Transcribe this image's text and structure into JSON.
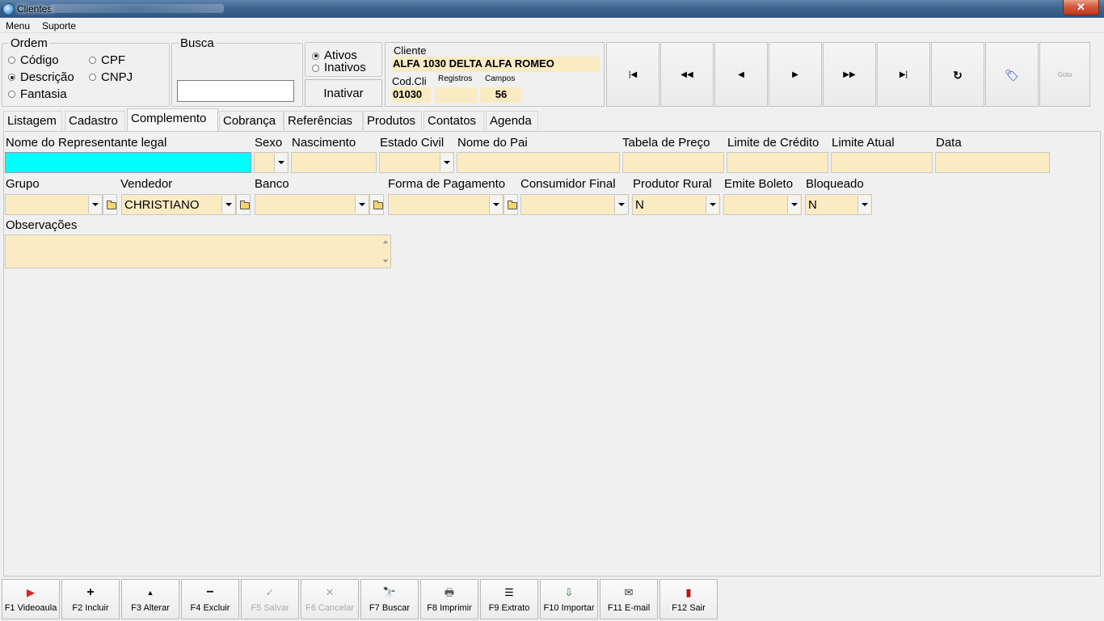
{
  "window": {
    "title": "Clientes",
    "close_label": "✕"
  },
  "menu": {
    "items": [
      "Menu",
      "Suporte"
    ]
  },
  "ordem": {
    "legend": "Ordem",
    "options": [
      {
        "label": "Código",
        "checked": false
      },
      {
        "label": "Descrição",
        "checked": true
      },
      {
        "label": "Fantasia",
        "checked": false
      },
      {
        "label": "CPF",
        "checked": false
      },
      {
        "label": "CNPJ",
        "checked": false
      }
    ]
  },
  "busca": {
    "legend": "Busca",
    "value": ""
  },
  "status": {
    "options": [
      {
        "label": "Ativos",
        "checked": true
      },
      {
        "label": "Inativos",
        "checked": false
      }
    ],
    "inativar_label": "Inativar"
  },
  "cliente": {
    "label": "Cliente",
    "name": "ALFA 1030 DELTA ALFA ROMEO",
    "cod_label": "Cod.Cli",
    "cod_value": "01030",
    "registros_label": "Registros",
    "registros_value": "",
    "campos_label": "Campos",
    "campos_value": "56"
  },
  "nav_buttons": [
    {
      "name": "first-record-button",
      "icon": "first-icon",
      "glyph": "|◀"
    },
    {
      "name": "prev-page-button",
      "icon": "rewind-icon",
      "glyph": "◀◀"
    },
    {
      "name": "prev-record-button",
      "icon": "prev-icon",
      "glyph": "◀"
    },
    {
      "name": "next-record-button",
      "icon": "next-icon",
      "glyph": "▶"
    },
    {
      "name": "next-page-button",
      "icon": "fast-forward-icon",
      "glyph": "▶▶"
    },
    {
      "name": "last-record-button",
      "icon": "last-icon",
      "glyph": "▶|"
    },
    {
      "name": "refresh-button",
      "icon": "refresh-icon",
      "glyph": "↻"
    },
    {
      "name": "tag-button",
      "icon": "tag-icon",
      "glyph": "🏷"
    },
    {
      "name": "goto-button",
      "icon": "goto-icon",
      "glyph": "Goto"
    }
  ],
  "tabs": [
    "Listagem",
    "Cadastro",
    "Complemento",
    "Cobrança",
    "Referências",
    "Produtos",
    "Contatos",
    "Agenda"
  ],
  "active_tab": "Complemento",
  "form": {
    "row1": {
      "representante_label": "Nome do Representante legal",
      "representante_value": "",
      "sexo_label": "Sexo",
      "sexo_value": "",
      "nascimento_label": "Nascimento",
      "nascimento_value": "",
      "estado_civil_label": "Estado Civil",
      "estado_civil_value": "",
      "nome_pai_label": "Nome do Pai",
      "nome_pai_value": "",
      "tabela_preco_label": "Tabela de Preço",
      "tabela_preco_value": "",
      "limite_credito_label": "Limite de Crédito",
      "limite_credito_value": "",
      "limite_atual_label": "Limite Atual",
      "limite_atual_value": "",
      "data_label": "Data",
      "data_value": ""
    },
    "row2": {
      "grupo_label": "Grupo",
      "grupo_value": "",
      "vendedor_label": "Vendedor",
      "vendedor_value": "CHRISTIANO",
      "banco_label": "Banco",
      "banco_value": "",
      "forma_pagamento_label": "Forma de Pagamento",
      "forma_pagamento_value": "",
      "consumidor_final_label": "Consumidor Final",
      "consumidor_final_value": "",
      "produtor_rural_label": "Produtor Rural",
      "produtor_rural_value": "N",
      "emite_boleto_label": "Emite Boleto",
      "emite_boleto_value": "",
      "bloqueado_label": "Bloqueado",
      "bloqueado_value": "N"
    },
    "observacoes_label": "Observações",
    "observacoes_value": ""
  },
  "toolbar": [
    {
      "key": "F1",
      "label": "F1 Videoaula",
      "icon": "youtube-icon",
      "glyph": "▶",
      "color": "#e02020",
      "disabled": false
    },
    {
      "key": "F2",
      "label": "F2 Incluir",
      "icon": "plus-icon",
      "glyph": "+",
      "color": "#000000",
      "disabled": false
    },
    {
      "key": "F3",
      "label": "F3 Alterar",
      "icon": "caret-up-icon",
      "glyph": "▲",
      "color": "#000000",
      "disabled": false
    },
    {
      "key": "F4",
      "label": "F4 Excluir",
      "icon": "minus-icon",
      "glyph": "−",
      "color": "#000000",
      "disabled": false
    },
    {
      "key": "F5",
      "label": "F5 Salvar",
      "icon": "check-icon",
      "glyph": "✓",
      "color": "#a8a8a8",
      "disabled": true
    },
    {
      "key": "F6",
      "label": "F6 Cancelar",
      "icon": "x-icon",
      "glyph": "✕",
      "color": "#a8a8a8",
      "disabled": true
    },
    {
      "key": "F7",
      "label": "F7 Buscar",
      "icon": "binoculars-icon",
      "glyph": "🔭",
      "color": "#000000",
      "disabled": false
    },
    {
      "key": "F8",
      "label": "F8 Imprimir",
      "icon": "printer-icon",
      "glyph": "🖶",
      "color": "#555555",
      "disabled": false
    },
    {
      "key": "F9",
      "label": "F9 Extrato",
      "icon": "list-icon",
      "glyph": "☰",
      "color": "#000000",
      "disabled": false
    },
    {
      "key": "F10",
      "label": "F10 Importar",
      "icon": "import-icon",
      "glyph": "⇩",
      "color": "#2a7a2a",
      "disabled": false
    },
    {
      "key": "F11",
      "label": "F11 E-mail",
      "icon": "envelope-icon",
      "glyph": "✉",
      "color": "#333333",
      "disabled": false
    },
    {
      "key": "F12",
      "label": "F12 Sair",
      "icon": "exit-door-icon",
      "glyph": "▮",
      "color": "#c01010",
      "disabled": false
    }
  ]
}
